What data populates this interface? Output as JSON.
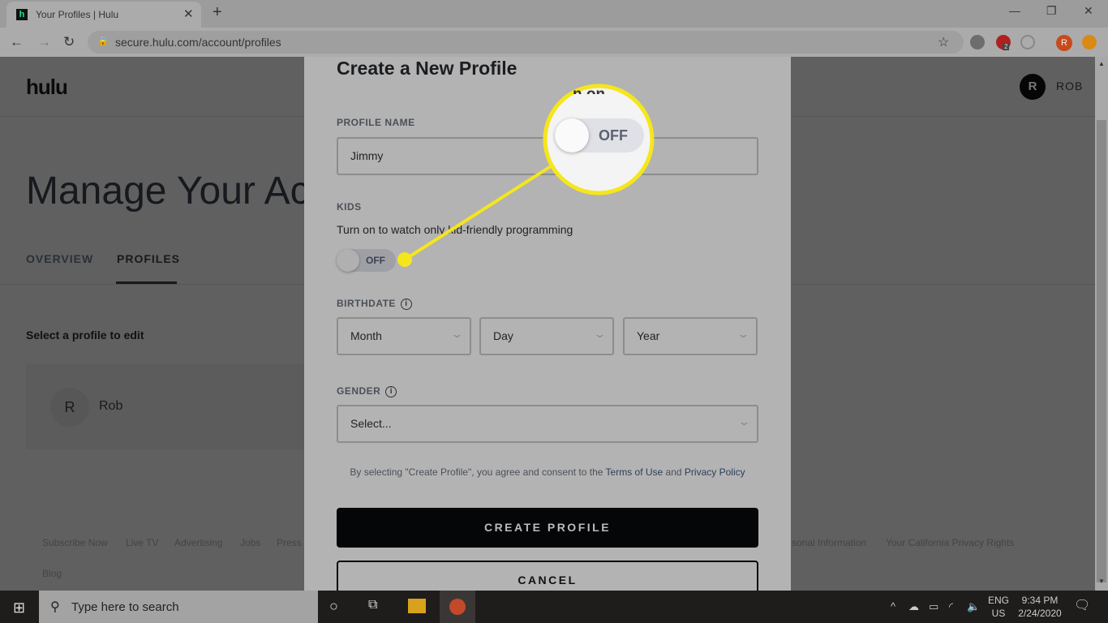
{
  "browser": {
    "tab_title": "Your Profiles | Hulu",
    "favicon_letter": "h",
    "url": "secure.hulu.com/account/profiles",
    "profile_letter": "R",
    "badge_count": "2"
  },
  "header": {
    "logo": "hulu",
    "avatar_letter": "R",
    "username": "ROB"
  },
  "page": {
    "title": "Manage Your Ac",
    "tabs": [
      {
        "label": "OVERVIEW"
      },
      {
        "label": "PROFILES",
        "active": true
      }
    ],
    "select_label": "Select a profile to edit",
    "profile": {
      "initial": "R",
      "name": "Rob"
    }
  },
  "footer": {
    "links": [
      "Subscribe Now",
      "Live TV",
      "Advertising",
      "Jobs",
      "Press",
      "sonal Information",
      "Your California Privacy Rights",
      "Blog"
    ]
  },
  "modal": {
    "title": "Create a New Profile",
    "profile_name_label": "PROFILE NAME",
    "profile_name_value": "Jimmy",
    "kids_label": "KIDS",
    "kids_desc": "Turn on to watch only kid-friendly programming",
    "kids_toggle": "OFF",
    "birthdate_label": "BIRTHDATE",
    "month": "Month",
    "day": "Day",
    "year": "Year",
    "gender_label": "GENDER",
    "gender_value": "Select...",
    "consent_prefix": "By selecting \"Create Profile\", you agree and consent to the ",
    "terms": "Terms of Use",
    "and": " and ",
    "privacy": "Privacy Policy",
    "create": "CREATE PROFILE",
    "cancel": "CANCEL"
  },
  "callout": {
    "toggle": "OFF",
    "partial_text": "n on",
    "color": "#f5e61c"
  },
  "taskbar": {
    "search_placeholder": "Type here to search",
    "lang1": "ENG",
    "lang2": "US",
    "time": "9:34 PM",
    "date": "2/24/2020"
  }
}
